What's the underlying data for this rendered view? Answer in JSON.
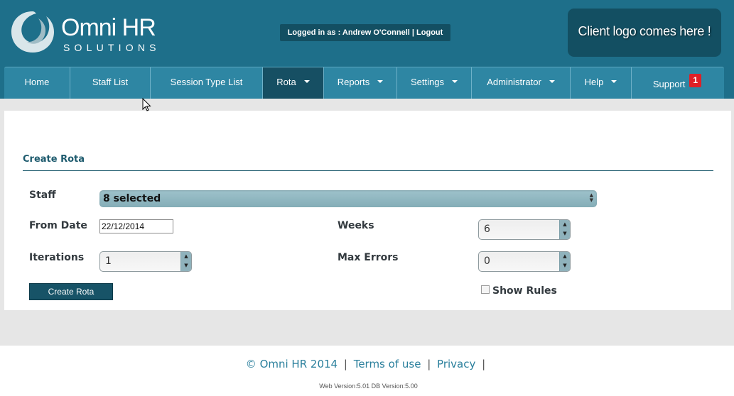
{
  "header": {
    "brand_name": "Omni HR",
    "brand_tagline": "SOLUTIONS",
    "login_prefix": "Logged in as : ",
    "user_name": "Andrew O'Connell",
    "separator": " | ",
    "logout_label": "Logout",
    "client_logo_text": "Client logo comes here !"
  },
  "nav": {
    "items": [
      {
        "label": "Home"
      },
      {
        "label": "Staff List"
      },
      {
        "label": "Session Type List"
      },
      {
        "label": "Rota"
      },
      {
        "label": "Reports"
      },
      {
        "label": "Settings"
      },
      {
        "label": "Administrator"
      },
      {
        "label": "Help"
      },
      {
        "label": "Support",
        "badge": "1"
      }
    ],
    "active": "Rota"
  },
  "form": {
    "title": "Create Rota",
    "staff_label": "Staff",
    "staff_value": "8 selected",
    "from_date_label": "From Date",
    "from_date_value": "22/12/2014",
    "weeks_label": "Weeks",
    "weeks_value": "6",
    "iterations_label": "Iterations",
    "iterations_value": "1",
    "max_errors_label": "Max Errors",
    "max_errors_value": "0",
    "create_button": "Create Rota",
    "show_rules_label": "Show Rules",
    "show_rules_checked": false
  },
  "footer": {
    "copyright": "© Omni HR 2014",
    "separator": "|",
    "terms_label": "Terms of use",
    "privacy_label": "Privacy",
    "version_text": "Web Version:5.01 DB Version:5.00"
  },
  "colors": {
    "header_bg": "#1e6f8a",
    "nav_bg": "#2e86a3",
    "nav_active_bg": "#164f63",
    "accent_dark": "#175367",
    "badge_red": "#e01f26"
  }
}
